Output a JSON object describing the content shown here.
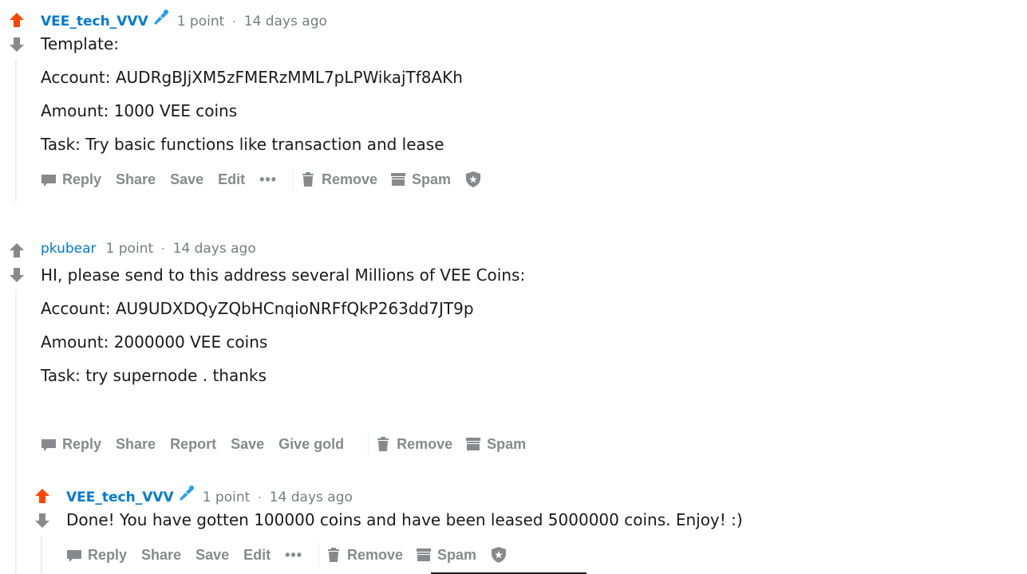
{
  "comments": [
    {
      "author": "VEE_tech_VVV",
      "points": "1 point",
      "dot": "·",
      "time": "14 days ago",
      "upvoted": true,
      "lines": [
        "Template:",
        "Account: AUDRgBJjXM5zFMERzMML7pLPWikajTf8AKh",
        "Amount: 1000 VEE coins",
        "Task: Try basic functions like transaction and lease"
      ],
      "actions": {
        "reply": "Reply",
        "share": "Share",
        "save": "Save",
        "edit": "Edit",
        "more": "•••",
        "remove": "Remove",
        "spam": "Spam"
      }
    },
    {
      "author": "pkubear",
      "points": "1 point",
      "dot": "·",
      "time": "14 days ago",
      "upvoted": false,
      "lines": [
        "HI, please send to this address several Millions of VEE Coins:",
        "Account: AU9UDXDQyZQbHCnqioNRFfQkP263dd7JT9p",
        "Amount: 2000000 VEE coins",
        "Task: try supernode . thanks"
      ],
      "actions": {
        "reply": "Reply",
        "share": "Share",
        "report": "Report",
        "save": "Save",
        "give_gold": "Give gold",
        "remove": "Remove",
        "spam": "Spam"
      }
    },
    {
      "author": "VEE_tech_VVV",
      "points": "1 point",
      "dot": "·",
      "time": "14 days ago",
      "upvoted": true,
      "lines": [
        "Done! You have gotten 100000 coins and have been leased 5000000 coins. Enjoy! :)"
      ],
      "actions": {
        "reply": "Reply",
        "share": "Share",
        "save": "Save",
        "edit": "Edit",
        "more": "•••",
        "remove": "Remove",
        "spam": "Spam"
      }
    }
  ],
  "colors": {
    "upvote": "#ff4500",
    "vote_neutral": "#878a8c",
    "author": "#0079d3",
    "meta": "#787c7e",
    "mic": "#24a0ed"
  },
  "icons": {
    "up": "arrow-up-icon",
    "down": "arrow-down-icon",
    "mic": "microphone-icon",
    "reply": "comment-bubble-icon",
    "trash": "trash-icon",
    "spam": "spam-box-icon",
    "shield": "shield-icon"
  }
}
